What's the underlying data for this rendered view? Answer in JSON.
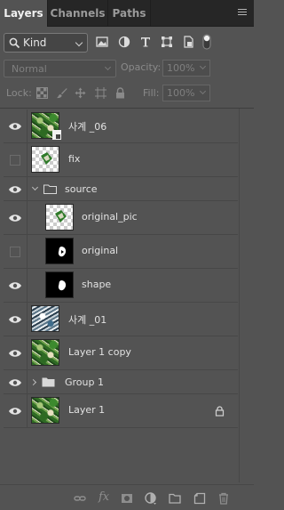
{
  "tabs": [
    {
      "label": "Layers",
      "active": true
    },
    {
      "label": "Channels",
      "active": false
    },
    {
      "label": "Paths",
      "active": false
    }
  ],
  "filter": {
    "kind_label": "Kind",
    "icons": [
      "image-filter-icon",
      "adjustment-filter-icon",
      "type-filter-icon",
      "shape-filter-icon",
      "smart-object-filter-icon",
      "filter-toggle-icon"
    ]
  },
  "blend": {
    "mode": "Normal",
    "opacity_label": "Opacity:",
    "opacity_value": "100%",
    "fill_label": "Fill:",
    "fill_value": "100%"
  },
  "lock": {
    "label": "Lock:",
    "icons": [
      "lock-transparent-pixels-icon",
      "lock-image-pixels-icon",
      "lock-position-icon",
      "lock-artboard-icon",
      "lock-all-icon"
    ]
  },
  "layers": [
    {
      "name": "사계 _06",
      "visible": true,
      "thumb": "photo",
      "smart_object": true,
      "indent": 0
    },
    {
      "name": "fix",
      "visible": false,
      "thumb": "checker",
      "indent": 0
    },
    {
      "name": "source",
      "visible": true,
      "group": true,
      "expanded": true,
      "indent": 0
    },
    {
      "name": "original_pic",
      "visible": true,
      "thumb": "checker",
      "indent": 1
    },
    {
      "name": "original",
      "visible": false,
      "thumb": "black",
      "indent": 1
    },
    {
      "name": "shape",
      "visible": true,
      "thumb": "black",
      "indent": 1
    },
    {
      "name": "사계 _01",
      "visible": true,
      "thumb": "photo2",
      "indent": 0
    },
    {
      "name": "Layer 1 copy",
      "visible": true,
      "thumb": "photo",
      "indent": 0
    },
    {
      "name": "Group 1",
      "visible": true,
      "group": true,
      "expanded": false,
      "indent": 0
    },
    {
      "name": "Layer 1",
      "visible": true,
      "thumb": "photo",
      "locked": true,
      "indent": 0
    }
  ],
  "bottom_icons": [
    "link-layers-icon",
    "fx-icon",
    "add-mask-icon",
    "new-adjustment-icon",
    "new-group-icon",
    "new-layer-icon",
    "delete-layer-icon"
  ],
  "bottom_fx_label": "fx",
  "colors": {
    "panel": "#535353",
    "tabbar": "#262626",
    "text": "#e2e2e2"
  }
}
